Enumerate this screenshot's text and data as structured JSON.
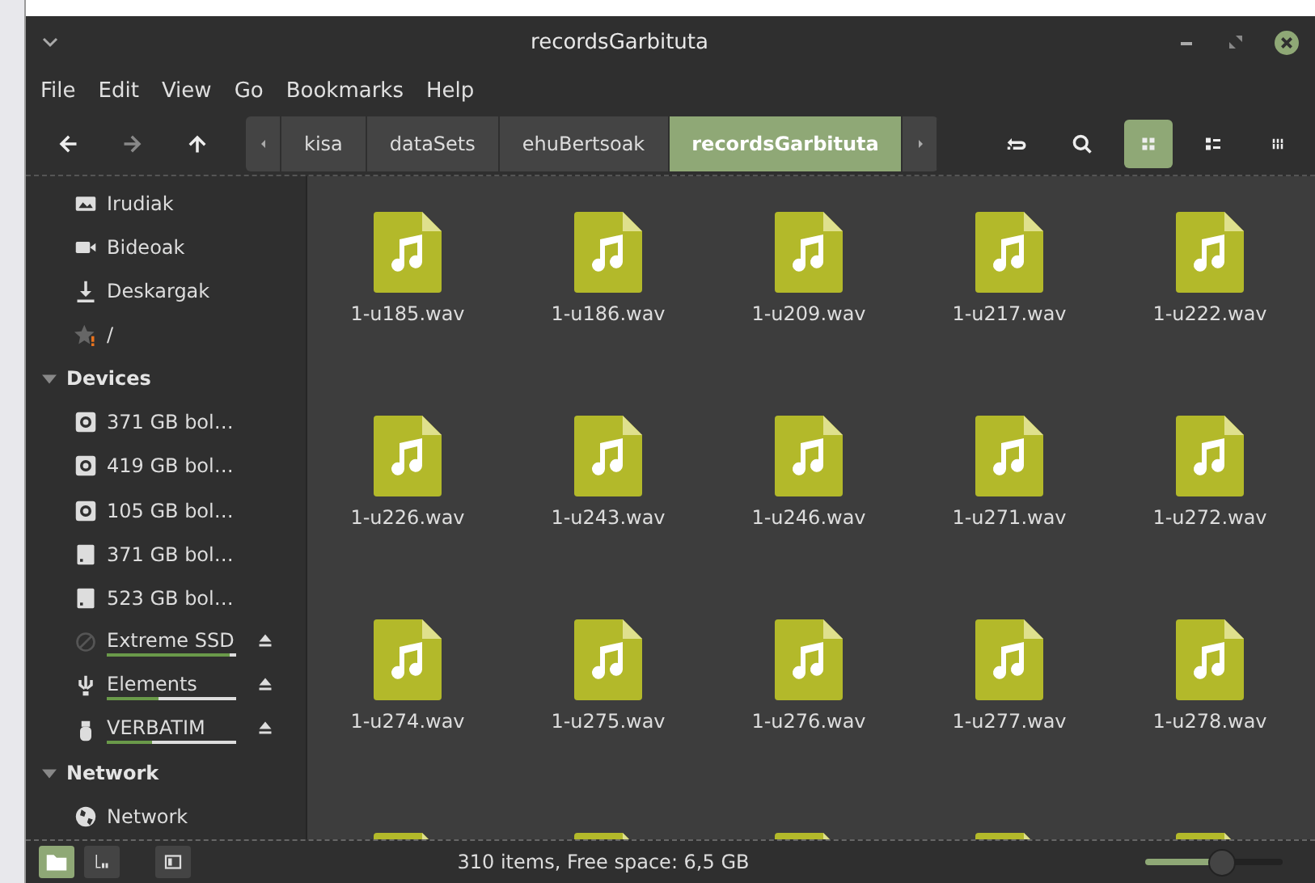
{
  "window": {
    "title": "recordsGarbituta"
  },
  "menu": [
    "File",
    "Edit",
    "View",
    "Go",
    "Bookmarks",
    "Help"
  ],
  "path": [
    {
      "label": "kisa",
      "selected": false
    },
    {
      "label": "dataSets",
      "selected": false
    },
    {
      "label": "ehuBertsoak",
      "selected": false
    },
    {
      "label": "recordsGarbituta",
      "selected": true
    }
  ],
  "view_modes": [
    {
      "kind": "icons",
      "selected": true
    },
    {
      "kind": "list",
      "selected": false
    },
    {
      "kind": "compact",
      "selected": false
    }
  ],
  "sidebar": {
    "places": [
      {
        "kind": "pictures",
        "label": "Irudiak"
      },
      {
        "kind": "videos",
        "label": "Bideoak"
      },
      {
        "kind": "downloads",
        "label": "Deskargak"
      },
      {
        "kind": "broken",
        "label": "/"
      }
    ],
    "sections": [
      {
        "title": "Devices",
        "expanded": true,
        "items": [
          {
            "kind": "disk",
            "label": "371 GB bol…"
          },
          {
            "kind": "disk",
            "label": "419 GB bol…"
          },
          {
            "kind": "disk",
            "label": "105 GB bol…"
          },
          {
            "kind": "drive",
            "label": "371 GB bol…"
          },
          {
            "kind": "drive",
            "label": "523 GB bol…"
          },
          {
            "kind": "unmounted",
            "label": "Extreme SSD",
            "level": 0.95,
            "ejectable": true
          },
          {
            "kind": "usb",
            "label": "Elements",
            "level": 0.4,
            "ejectable": true
          },
          {
            "kind": "stick",
            "label": "VERBATIM",
            "level": 0.35,
            "ejectable": true
          }
        ]
      },
      {
        "title": "Network",
        "expanded": true,
        "items": [
          {
            "kind": "network",
            "label": "Network"
          }
        ]
      }
    ]
  },
  "files": [
    {
      "kind": "file",
      "name": "1-u185.wav"
    },
    {
      "kind": "file",
      "name": "1-u186.wav"
    },
    {
      "kind": "file",
      "name": "1-u209.wav"
    },
    {
      "kind": "file",
      "name": "1-u217.wav"
    },
    {
      "kind": "file",
      "name": "1-u222.wav"
    },
    {
      "kind": "file",
      "name": "1-u226.wav"
    },
    {
      "kind": "file",
      "name": "1-u243.wav"
    },
    {
      "kind": "file",
      "name": "1-u246.wav"
    },
    {
      "kind": "file",
      "name": "1-u271.wav"
    },
    {
      "kind": "file",
      "name": "1-u272.wav"
    },
    {
      "kind": "file",
      "name": "1-u274.wav"
    },
    {
      "kind": "file",
      "name": "1-u275.wav"
    },
    {
      "kind": "file",
      "name": "1-u276.wav"
    },
    {
      "kind": "file",
      "name": "1-u277.wav"
    },
    {
      "kind": "file",
      "name": "1-u278.wav"
    },
    {
      "kind": "partial"
    },
    {
      "kind": "partial"
    },
    {
      "kind": "partial"
    },
    {
      "kind": "partial"
    },
    {
      "kind": "partial"
    }
  ],
  "sidebar_modes": [
    {
      "kind": "places",
      "selected": true
    },
    {
      "kind": "tree",
      "selected": false
    }
  ],
  "status_bar": {
    "text": "310 items, Free space: 6,5 GB",
    "zoom": {
      "level": 0.55
    }
  }
}
